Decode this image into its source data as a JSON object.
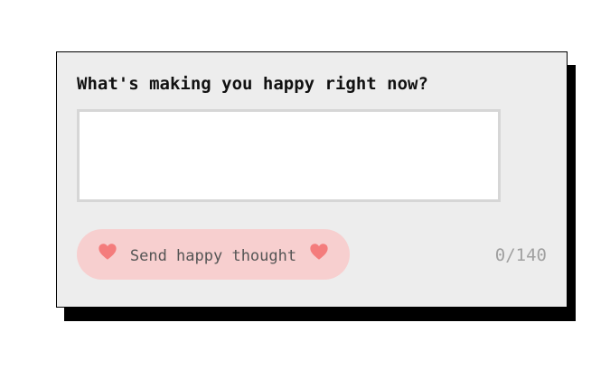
{
  "form": {
    "question": "What's making you happy right now?",
    "input_value": "",
    "input_placeholder": "",
    "send_label": "Send happy thought",
    "counter": "0/140",
    "icons": [
      "heart-icon",
      "heart-icon"
    ]
  },
  "colors": {
    "card_background": "#ededed",
    "button_background": "#f7cfcf",
    "heart": "#f47c7c",
    "counter_text": "#a0a0a0"
  }
}
